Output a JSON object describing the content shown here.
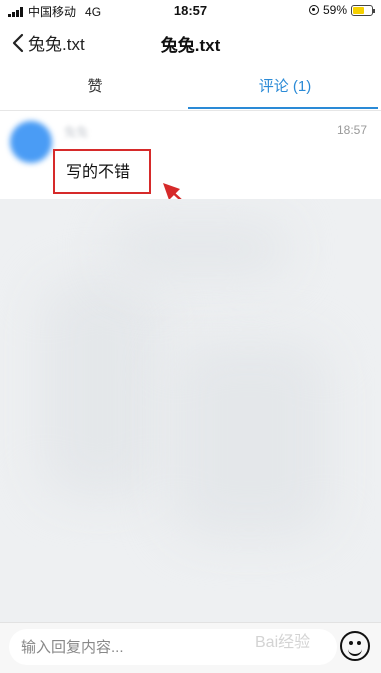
{
  "status_bar": {
    "carrier": "中国移动",
    "network": "4G",
    "time": "18:57",
    "battery": "59%",
    "battery_level": 0.59
  },
  "nav": {
    "back_label": "兔兔.txt",
    "title": "兔兔.txt"
  },
  "tabs": [
    {
      "label": "赞",
      "active": false
    },
    {
      "label": "评论 (1)",
      "active": true
    }
  ],
  "comment": {
    "user_name": "兔兔",
    "time": "18:57",
    "text": "写的不错"
  },
  "reply": {
    "placeholder": "输入回复内容..."
  },
  "watermark": "Bai经验",
  "colors": {
    "accent": "#2a8ad6",
    "highlight": "#d62a2a",
    "avatar": "#4a9cf5"
  }
}
